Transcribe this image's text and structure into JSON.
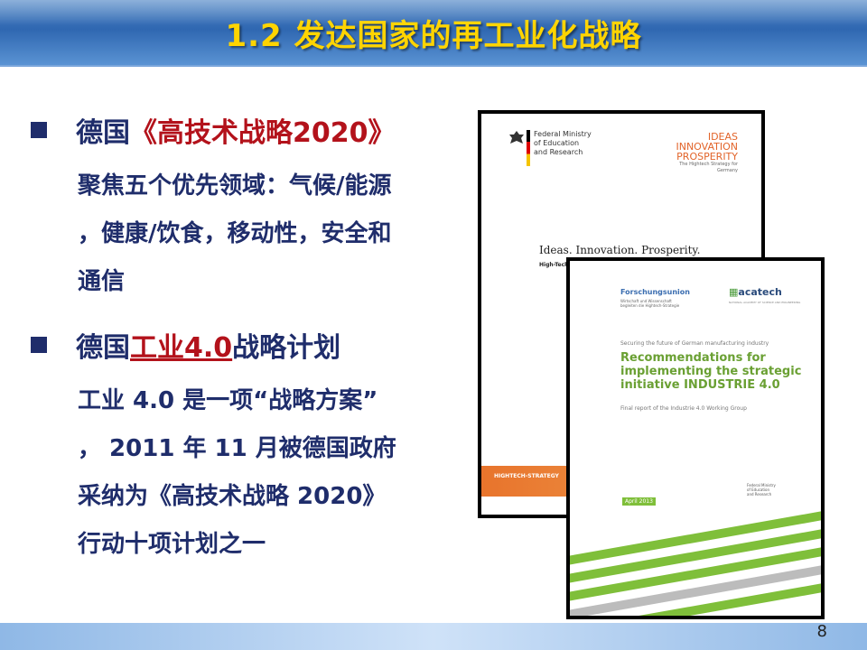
{
  "title": "1.2 发达国家的再工业化战略",
  "bullets": [
    {
      "prefix": "德国",
      "highlight": "《高技术战略2020》",
      "suffix": "",
      "text_lines": [
        "聚焦五个优先领域：气候/能源",
        "，健康/饮食，移动性，安全和",
        "通信"
      ]
    },
    {
      "prefix": "德国",
      "highlight": "工业4.0",
      "suffix": "战略计划",
      "text_lines": [
        "工业 4.0 是一项“战略方案”",
        "， 2011 年 11 月被德国政府",
        "采纳为《高技术战略 2020》",
        "行动十项计划之一"
      ]
    }
  ],
  "doc_front": {
    "ministry": [
      "Federal Ministry",
      "of Education",
      "and Research"
    ],
    "brand": [
      "IDEAS",
      "INNOVATION",
      "PROSPERITY"
    ],
    "brand_sub": "The Hightech Strategy for Germany",
    "headline": "Ideas. Innovation. Prosperity.",
    "subhead": "High-Tech S",
    "footer_tag": "HIGHTECH-STRATEGY"
  },
  "doc_back": {
    "org_left": "Forschungsunion",
    "org_left_sub": [
      "Wirtschaft und Wissenschaft",
      "begleiten die Hightech-Strategie"
    ],
    "org_right": "acatech",
    "org_right_sub": "NATIONAL ACADEMY OF SCIENCE AND ENGINEERING",
    "kicker": "Securing the future of German manufacturing industry",
    "headline": [
      "Recommendations for",
      "implementing the strategic",
      "initiative INDUSTRIE 4.0"
    ],
    "subtitle": "Final report of the Industrie 4.0 Working Group",
    "date": "April 2013",
    "sponsor": [
      "Federal Ministry",
      "of Education",
      "and Research"
    ]
  },
  "page_number": "8",
  "colors": {
    "navy": "#1f2d6b",
    "red": "#b3121b",
    "title_yellow": "#ffd400",
    "banner_blue": "#2f67b1",
    "green": "#7fbf3a"
  }
}
